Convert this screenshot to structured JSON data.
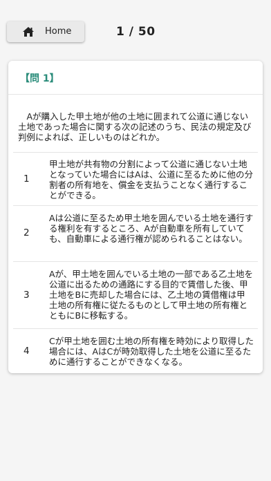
{
  "header": {
    "home_label": "Home",
    "progress": "1 / 50"
  },
  "question": {
    "title": "【問 1】",
    "text": "　Aが購入した甲土地が他の土地に囲まれて公道に通じない土地であった場合に関する次の記述のうち、民法の規定及び判例によれば、正しいものはどれか。",
    "choices": [
      {
        "num": "1",
        "text": "甲土地が共有物の分割によって公道に通じない土地となっていた場合にはAは、公道に至るために他の分割者の所有地を、償金を支払うことなく通行することができる。"
      },
      {
        "num": "2",
        "text": "Aは公道に至るため甲土地を囲んでいる土地を通行する権利を有するところ、Aが自動車を所有していても、自動車による通行権が認められることはない。"
      },
      {
        "num": "3",
        "text": "Aが、甲土地を囲んでいる土地の一部である乙土地を公道に出るための通路にする目的で賃借した後、甲土地をBに売却した場合には、乙土地の賃借権は甲土地の所有権に従たるものとして甲土地の所有権とともにBに移転する。"
      },
      {
        "num": "4",
        "text": "Cが甲土地を囲む土地の所有権を時効により取得した場合には、AはCが時効取得した土地を公道に至るために通行することができなくなる。"
      }
    ]
  },
  "colors": {
    "accent": "#2a8c7a",
    "background": "#f5f5f5",
    "card": "#ffffff"
  },
  "icons": {
    "home": "home-icon"
  }
}
